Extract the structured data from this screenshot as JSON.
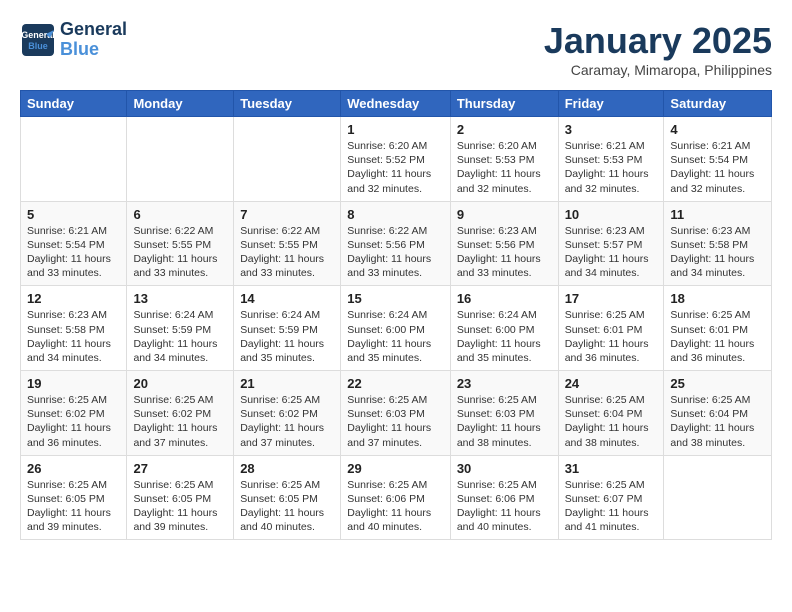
{
  "header": {
    "logo_line1": "General",
    "logo_line2": "Blue",
    "month": "January 2025",
    "location": "Caramay, Mimaropa, Philippines"
  },
  "weekdays": [
    "Sunday",
    "Monday",
    "Tuesday",
    "Wednesday",
    "Thursday",
    "Friday",
    "Saturday"
  ],
  "weeks": [
    [
      {
        "day": "",
        "info": ""
      },
      {
        "day": "",
        "info": ""
      },
      {
        "day": "",
        "info": ""
      },
      {
        "day": "1",
        "info": "Sunrise: 6:20 AM\nSunset: 5:52 PM\nDaylight: 11 hours\nand 32 minutes."
      },
      {
        "day": "2",
        "info": "Sunrise: 6:20 AM\nSunset: 5:53 PM\nDaylight: 11 hours\nand 32 minutes."
      },
      {
        "day": "3",
        "info": "Sunrise: 6:21 AM\nSunset: 5:53 PM\nDaylight: 11 hours\nand 32 minutes."
      },
      {
        "day": "4",
        "info": "Sunrise: 6:21 AM\nSunset: 5:54 PM\nDaylight: 11 hours\nand 32 minutes."
      }
    ],
    [
      {
        "day": "5",
        "info": "Sunrise: 6:21 AM\nSunset: 5:54 PM\nDaylight: 11 hours\nand 33 minutes."
      },
      {
        "day": "6",
        "info": "Sunrise: 6:22 AM\nSunset: 5:55 PM\nDaylight: 11 hours\nand 33 minutes."
      },
      {
        "day": "7",
        "info": "Sunrise: 6:22 AM\nSunset: 5:55 PM\nDaylight: 11 hours\nand 33 minutes."
      },
      {
        "day": "8",
        "info": "Sunrise: 6:22 AM\nSunset: 5:56 PM\nDaylight: 11 hours\nand 33 minutes."
      },
      {
        "day": "9",
        "info": "Sunrise: 6:23 AM\nSunset: 5:56 PM\nDaylight: 11 hours\nand 33 minutes."
      },
      {
        "day": "10",
        "info": "Sunrise: 6:23 AM\nSunset: 5:57 PM\nDaylight: 11 hours\nand 34 minutes."
      },
      {
        "day": "11",
        "info": "Sunrise: 6:23 AM\nSunset: 5:58 PM\nDaylight: 11 hours\nand 34 minutes."
      }
    ],
    [
      {
        "day": "12",
        "info": "Sunrise: 6:23 AM\nSunset: 5:58 PM\nDaylight: 11 hours\nand 34 minutes."
      },
      {
        "day": "13",
        "info": "Sunrise: 6:24 AM\nSunset: 5:59 PM\nDaylight: 11 hours\nand 34 minutes."
      },
      {
        "day": "14",
        "info": "Sunrise: 6:24 AM\nSunset: 5:59 PM\nDaylight: 11 hours\nand 35 minutes."
      },
      {
        "day": "15",
        "info": "Sunrise: 6:24 AM\nSunset: 6:00 PM\nDaylight: 11 hours\nand 35 minutes."
      },
      {
        "day": "16",
        "info": "Sunrise: 6:24 AM\nSunset: 6:00 PM\nDaylight: 11 hours\nand 35 minutes."
      },
      {
        "day": "17",
        "info": "Sunrise: 6:25 AM\nSunset: 6:01 PM\nDaylight: 11 hours\nand 36 minutes."
      },
      {
        "day": "18",
        "info": "Sunrise: 6:25 AM\nSunset: 6:01 PM\nDaylight: 11 hours\nand 36 minutes."
      }
    ],
    [
      {
        "day": "19",
        "info": "Sunrise: 6:25 AM\nSunset: 6:02 PM\nDaylight: 11 hours\nand 36 minutes."
      },
      {
        "day": "20",
        "info": "Sunrise: 6:25 AM\nSunset: 6:02 PM\nDaylight: 11 hours\nand 37 minutes."
      },
      {
        "day": "21",
        "info": "Sunrise: 6:25 AM\nSunset: 6:02 PM\nDaylight: 11 hours\nand 37 minutes."
      },
      {
        "day": "22",
        "info": "Sunrise: 6:25 AM\nSunset: 6:03 PM\nDaylight: 11 hours\nand 37 minutes."
      },
      {
        "day": "23",
        "info": "Sunrise: 6:25 AM\nSunset: 6:03 PM\nDaylight: 11 hours\nand 38 minutes."
      },
      {
        "day": "24",
        "info": "Sunrise: 6:25 AM\nSunset: 6:04 PM\nDaylight: 11 hours\nand 38 minutes."
      },
      {
        "day": "25",
        "info": "Sunrise: 6:25 AM\nSunset: 6:04 PM\nDaylight: 11 hours\nand 38 minutes."
      }
    ],
    [
      {
        "day": "26",
        "info": "Sunrise: 6:25 AM\nSunset: 6:05 PM\nDaylight: 11 hours\nand 39 minutes."
      },
      {
        "day": "27",
        "info": "Sunrise: 6:25 AM\nSunset: 6:05 PM\nDaylight: 11 hours\nand 39 minutes."
      },
      {
        "day": "28",
        "info": "Sunrise: 6:25 AM\nSunset: 6:05 PM\nDaylight: 11 hours\nand 40 minutes."
      },
      {
        "day": "29",
        "info": "Sunrise: 6:25 AM\nSunset: 6:06 PM\nDaylight: 11 hours\nand 40 minutes."
      },
      {
        "day": "30",
        "info": "Sunrise: 6:25 AM\nSunset: 6:06 PM\nDaylight: 11 hours\nand 40 minutes."
      },
      {
        "day": "31",
        "info": "Sunrise: 6:25 AM\nSunset: 6:07 PM\nDaylight: 11 hours\nand 41 minutes."
      },
      {
        "day": "",
        "info": ""
      }
    ]
  ]
}
